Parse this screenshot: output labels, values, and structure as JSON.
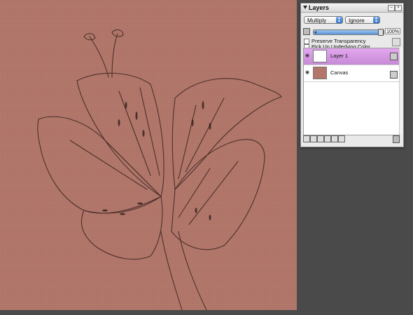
{
  "palette": {
    "title": "Layers",
    "blend_mode": "Multiply",
    "composite_mode": "Ignore",
    "opacity": "100%",
    "opacity_level": 1.0,
    "preserve_transparency_label": "Preserve Transparency",
    "pick_up_label": "Pick Up Underlying Color",
    "layers": [
      {
        "name": "Layer 1",
        "selected": true
      },
      {
        "name": "Canvas",
        "selected": false
      }
    ]
  },
  "colors": {
    "canvas": "#b2766a",
    "background": "#4a4a4a",
    "selected_layer": "#d597e3",
    "slider": "#6aa3df"
  },
  "icons": {
    "eye": "eye-icon",
    "lock": "lock-icon",
    "trash": "trash-icon",
    "close": "close-icon",
    "collapse": "collapse-triangle-icon"
  }
}
